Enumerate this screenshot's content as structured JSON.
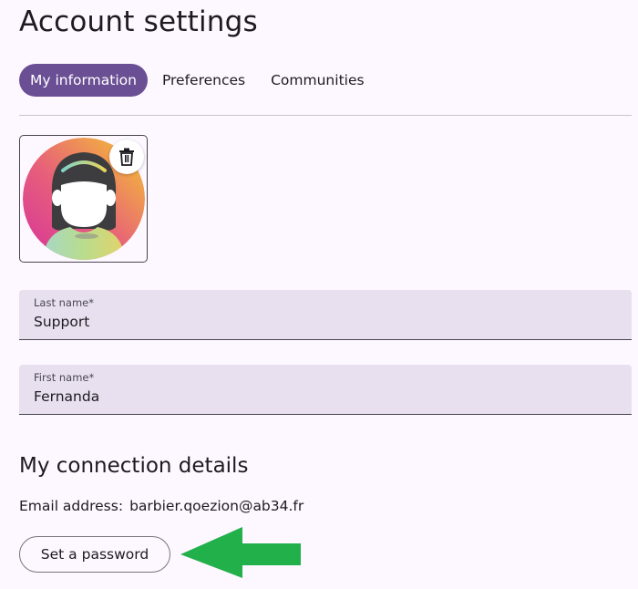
{
  "page": {
    "title": "Account settings"
  },
  "tabs": [
    {
      "label": "My information",
      "active": true
    },
    {
      "label": "Preferences",
      "active": false
    },
    {
      "label": "Communities",
      "active": false
    }
  ],
  "avatar": {
    "delete_icon": "trash-icon"
  },
  "form": {
    "last_name": {
      "label": "Last name*",
      "value": "Support"
    },
    "first_name": {
      "label": "First name*",
      "value": "Fernanda"
    }
  },
  "connection": {
    "title": "My connection details",
    "email_label": "Email address:",
    "email_value": "barbier.qoezion@ab34.fr",
    "password_button": "Set a password"
  },
  "annotation": {
    "arrow_icon": "left-arrow-icon",
    "arrow_color": "#22b04b"
  },
  "colors": {
    "accent": "#6b4f94",
    "background": "#fdf7ff",
    "field_background": "#e8e0ef"
  }
}
